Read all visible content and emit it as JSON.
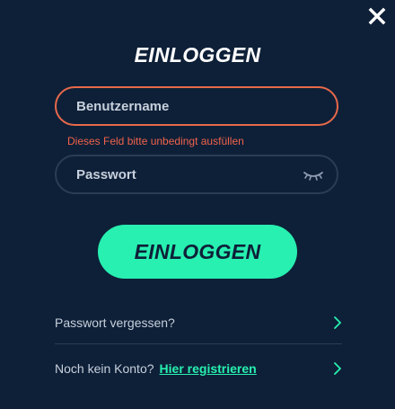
{
  "modal": {
    "title": "EINLOGGEN",
    "username": {
      "value": "",
      "placeholder": "Benutzername",
      "error": "Dieses Feld bitte unbedingt ausfüllen"
    },
    "password": {
      "value": "",
      "placeholder": "Passwort"
    },
    "submit_label": "EINLOGGEN",
    "forgot_password": "Passwort vergessen?",
    "no_account": "Noch kein Konto?",
    "register_link": "Hier registrieren"
  },
  "icons": {
    "close": "close-icon",
    "password_toggle": "eye-closed-icon",
    "chevron": "chevron-right-icon"
  },
  "colors": {
    "background": "#0e2038",
    "accent": "#27f0b0",
    "error": "#f0624a",
    "error_border": "#e8694a",
    "text": "#c7d0dc"
  }
}
